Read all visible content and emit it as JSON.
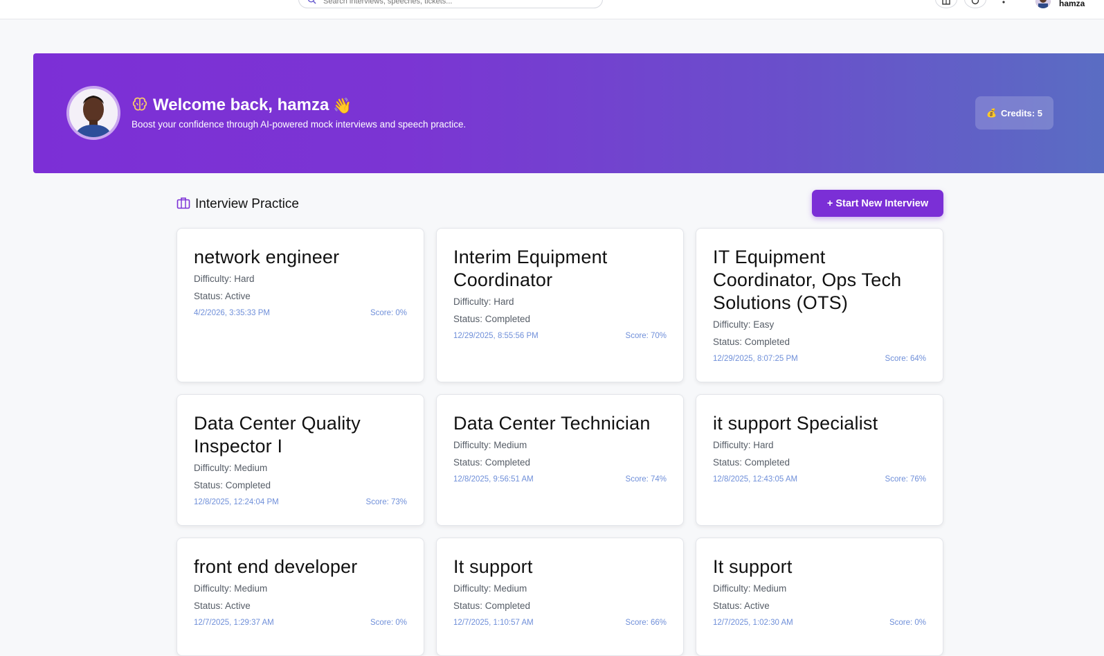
{
  "search": {
    "placeholder": "Search interviews, speeches, tickets..."
  },
  "user": {
    "name": "hamza"
  },
  "banner": {
    "greeting": "Welcome back, hamza",
    "wave": "👋",
    "tagline": "Boost your confidence through AI-powered mock interviews and speech practice.",
    "credits_icon": "💰",
    "credits_label": "Credits:",
    "credits_value": "5"
  },
  "section": {
    "title": "Interview Practice",
    "new_button": "+ Start New Interview"
  },
  "cards": [
    {
      "title": "network engineer",
      "difficulty": "Difficulty: Hard",
      "status": "Status: Active",
      "date": "4/2/2026, 3:35:33 PM",
      "score": "Score: 0%"
    },
    {
      "title": "Interim Equipment Coordinator",
      "difficulty": "Difficulty: Hard",
      "status": "Status: Completed",
      "date": "12/29/2025, 8:55:56 PM",
      "score": "Score: 70%"
    },
    {
      "title": "IT Equipment Coordinator, Ops Tech Solutions (OTS)",
      "difficulty": "Difficulty: Easy",
      "status": "Status: Completed",
      "date": "12/29/2025, 8:07:25 PM",
      "score": "Score: 64%"
    },
    {
      "title": "Data Center Quality Inspector I",
      "difficulty": "Difficulty: Medium",
      "status": "Status: Completed",
      "date": "12/8/2025, 12:24:04 PM",
      "score": "Score: 73%"
    },
    {
      "title": "Data Center Technician",
      "difficulty": "Difficulty: Medium",
      "status": "Status: Completed",
      "date": "12/8/2025, 9:56:51 AM",
      "score": "Score: 74%"
    },
    {
      "title": "it support Specialist",
      "difficulty": "Difficulty: Hard",
      "status": "Status: Completed",
      "date": "12/8/2025, 12:43:05 AM",
      "score": "Score: 76%"
    },
    {
      "title": "front end developer",
      "difficulty": "Difficulty: Medium",
      "status": "Status: Active",
      "date": "12/7/2025, 1:29:37 AM",
      "score": "Score: 0%"
    },
    {
      "title": "It support",
      "difficulty": "Difficulty: Medium",
      "status": "Status: Completed",
      "date": "12/7/2025, 1:10:57 AM",
      "score": "Score: 66%"
    },
    {
      "title": "It support",
      "difficulty": "Difficulty: Medium",
      "status": "Status: Active",
      "date": "12/7/2025, 1:02:30 AM",
      "score": "Score: 0%"
    }
  ],
  "colors": {
    "accent": "#7b2fd6",
    "banner_end": "#5a6dc3",
    "link": "#6f8fd9"
  }
}
